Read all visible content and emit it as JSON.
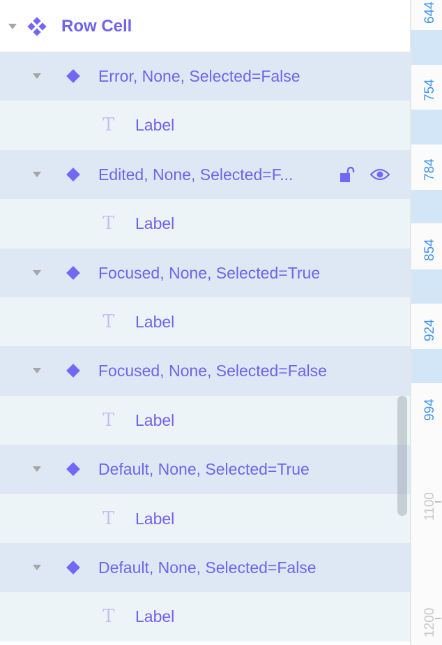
{
  "header": {
    "title": "Row Cell",
    "icon": "component-set-icon"
  },
  "rows": [
    {
      "type": "component",
      "label": "Error, None, Selected=False"
    },
    {
      "type": "text",
      "label": "Label"
    },
    {
      "type": "component",
      "label": "Edited, None, Selected=F...",
      "hovered": true,
      "actions": [
        "unlock-icon",
        "eye-icon"
      ]
    },
    {
      "type": "text",
      "label": "Label"
    },
    {
      "type": "component",
      "label": "Focused, None, Selected=True"
    },
    {
      "type": "text",
      "label": "Label"
    },
    {
      "type": "component",
      "label": "Focused, None, Selected=False"
    },
    {
      "type": "text",
      "label": "Label"
    },
    {
      "type": "component",
      "label": "Default, None, Selected=True"
    },
    {
      "type": "text",
      "label": "Label"
    },
    {
      "type": "component",
      "label": "Default, None, Selected=False"
    },
    {
      "type": "text",
      "label": "Label"
    }
  ],
  "ruler": {
    "highlighted_marks": [
      "644",
      "754",
      "784",
      "854",
      "924",
      "994"
    ],
    "marks": [
      "1100",
      "1200"
    ]
  },
  "colors": {
    "accent": "#7367f6",
    "ruler_highlight": "#3d94f2",
    "component_row_bg": "#dde8f4",
    "text_row_bg": "#edf4f8"
  }
}
